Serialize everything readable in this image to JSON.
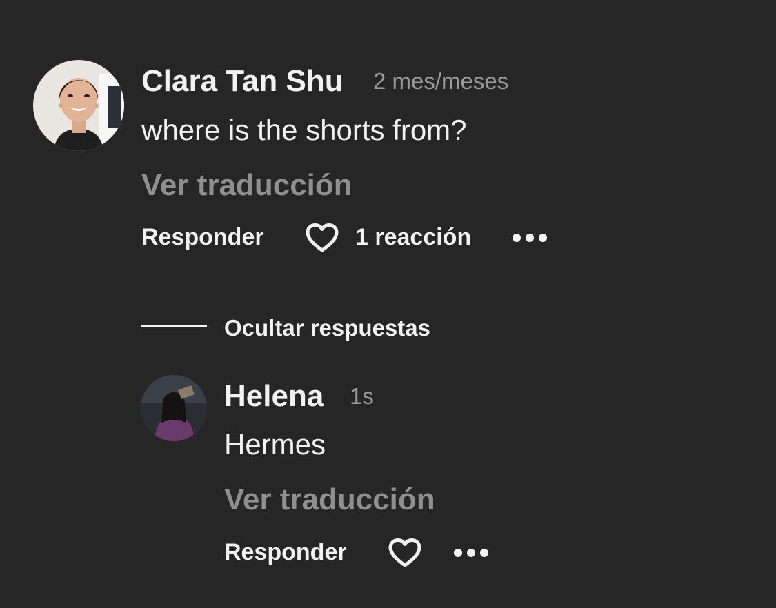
{
  "comment": {
    "author": "Clara Tan Shu",
    "time": "2 mes/meses",
    "text": "where is the shorts from?",
    "translate_label": "Ver traducción",
    "reply_label": "Responder",
    "reactions_label": "1 reacción",
    "more_icon": "more-horizontal-icon",
    "like_icon": "heart-outline-icon"
  },
  "replies_toggle": {
    "label": "Ocultar respuestas"
  },
  "reply": {
    "author": "Helena",
    "time": "1s",
    "text": "Hermes",
    "translate_label": "Ver traducción",
    "reply_label": "Responder",
    "more_icon": "more-horizontal-icon",
    "like_icon": "heart-outline-icon"
  }
}
